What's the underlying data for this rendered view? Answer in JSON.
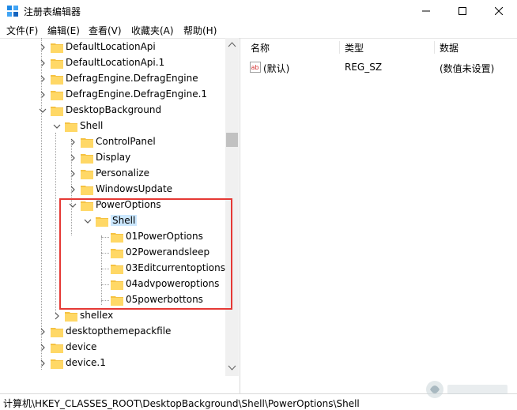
{
  "window": {
    "title": "注册表编辑器"
  },
  "menu": [
    "文件(F)",
    "编辑(E)",
    "查看(V)",
    "收藏夹(A)",
    "帮助(H)"
  ],
  "tree": [
    {
      "label": "DefaultLocationApi"
    },
    {
      "label": "DefaultLocationApi.1"
    },
    {
      "label": "DefragEngine.DefragEngine"
    },
    {
      "label": "DefragEngine.DefragEngine.1"
    },
    {
      "label": "DesktopBackground"
    },
    {
      "label": "Shell"
    },
    {
      "label": "ControlPanel"
    },
    {
      "label": "Display"
    },
    {
      "label": "Personalize"
    },
    {
      "label": "WindowsUpdate"
    },
    {
      "label": "PowerOptions"
    },
    {
      "label": "Shell"
    },
    {
      "label": "01PowerOptions"
    },
    {
      "label": "02Powerandsleep"
    },
    {
      "label": "03Editcurrentoptions"
    },
    {
      "label": "04advpoweroptions"
    },
    {
      "label": "05powerbottons"
    },
    {
      "label": "shellex"
    },
    {
      "label": "desktopthemepackfile"
    },
    {
      "label": "device"
    },
    {
      "label": "device.1"
    }
  ],
  "values": {
    "columns": [
      "名称",
      "类型",
      "数据"
    ],
    "rows": [
      {
        "name": "(默认)",
        "type": "REG_SZ",
        "data": "(数值未设置)"
      }
    ]
  },
  "status": {
    "path": "计算机\\HKEY_CLASSES_ROOT\\DesktopBackground\\Shell\\PowerOptions\\Shell"
  },
  "colors": {
    "folder": "#f5c242",
    "highlight": "#e53935",
    "selected": "#cce8ff"
  }
}
